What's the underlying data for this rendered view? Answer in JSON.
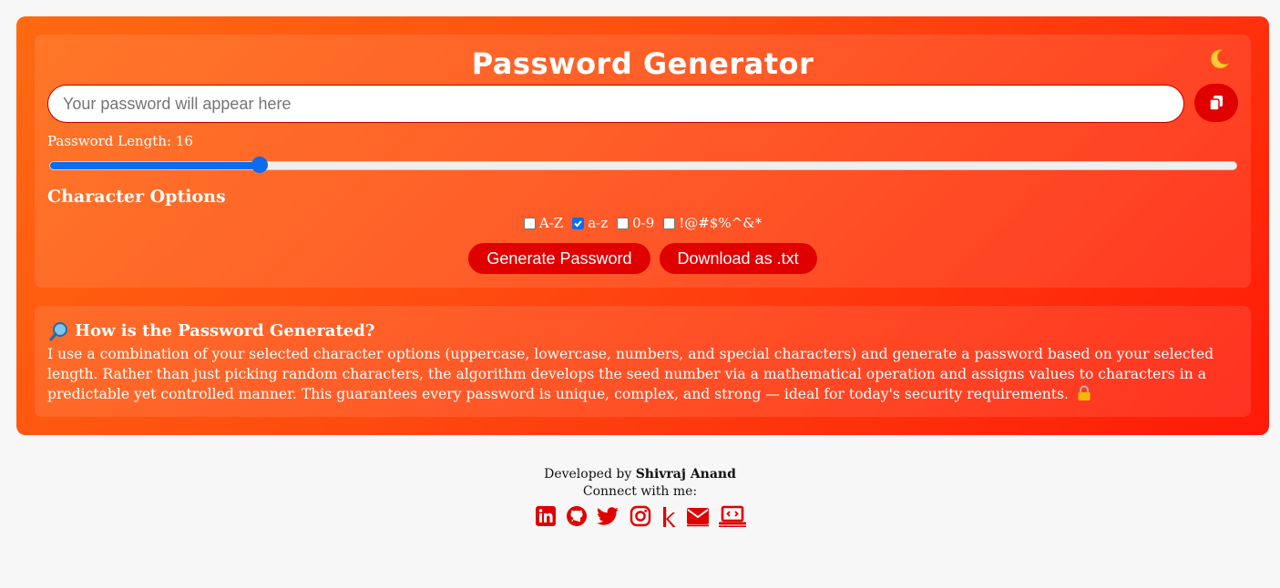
{
  "header": {
    "title": "Password Generator",
    "theme_toggle_icon": "moon-icon"
  },
  "password": {
    "value": "",
    "placeholder": "Your password will appear here",
    "copy_icon": "copy-icon"
  },
  "length": {
    "label": "Password Length:",
    "value": "16",
    "slider_fraction": 0.177
  },
  "options": {
    "heading": "Character Options",
    "items": [
      {
        "label": "A-Z",
        "checked": false
      },
      {
        "label": "a-z",
        "checked": true
      },
      {
        "label": "0-9",
        "checked": false
      },
      {
        "label": "!@#$%^&*",
        "checked": false
      }
    ]
  },
  "actions": {
    "generate_label": "Generate Password",
    "download_label": "Download as .txt"
  },
  "info": {
    "heading": "How is the Password Generated?",
    "heading_icon": "magnifier-icon",
    "body": "I use a combination of your selected character options (uppercase, lowercase, numbers, and special characters) and generate a password based on your selected length. Rather than just picking random characters, the algorithm develops the seed number via a mathematical operation and assigns values to characters in a predictable yet controlled manner. This guarantees every password is unique, complex, and strong — ideal for today's security requirements.",
    "trailing_icon": "lock-icon"
  },
  "footer": {
    "developed_by": "Developed by",
    "author": "Shivraj Anand",
    "connect": "Connect with me:",
    "social_icons": [
      "linkedin-icon",
      "github-icon",
      "twitter-icon",
      "instagram-icon",
      "kaggle-icon",
      "email-icon",
      "portfolio-icon"
    ]
  },
  "colors": {
    "accent_red": "#e00000",
    "slider_blue": "#0b6cf0",
    "gradient_start": "#ff6a10",
    "gradient_end": "#ff1a08"
  }
}
